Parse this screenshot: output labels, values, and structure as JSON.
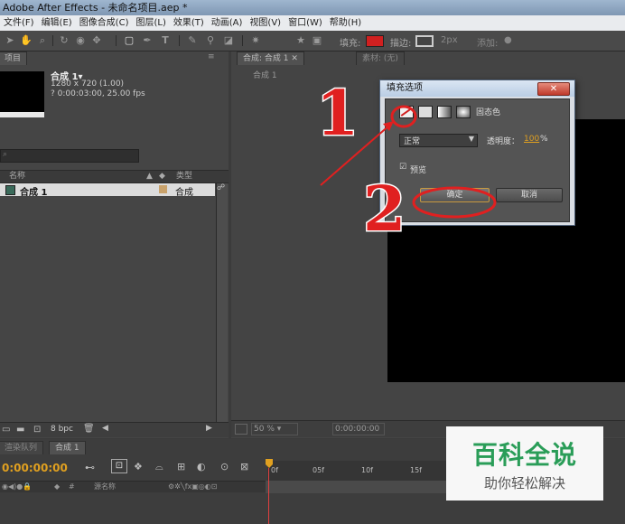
{
  "window_title": "Adobe After Effects - 未命名项目.aep *",
  "menu": [
    "文件(F)",
    "编辑(E)",
    "图像合成(C)",
    "图层(L)",
    "效果(T)",
    "动画(A)",
    "视图(V)",
    "窗口(W)",
    "帮助(H)"
  ],
  "toolbar": {
    "fill_label": "填充:",
    "stroke_label": "描边:",
    "stroke_width": "2px",
    "add_label": "添加:",
    "fill_color": "#d02020"
  },
  "project": {
    "tab": "项目",
    "comp_name": "合成 1▾",
    "comp_info1": "1280 x 720 (1.00)",
    "comp_info2": "? 0:00:03:00, 25.00 fps",
    "col_name": "名称",
    "col_type": "类型",
    "item_name": "合成 1",
    "item_type": "合成",
    "bpc": "8 bpc"
  },
  "composition": {
    "tab1": "合成: 合成 1",
    "tab2": "素材: (无)",
    "subtab": "合成 1",
    "zoom": "50 %",
    "timecode": "0:00:00:00"
  },
  "dialog": {
    "title": "填充选项",
    "fill_mode_label": "固态色",
    "blend_mode": "正常",
    "opacity_label": "透明度：",
    "opacity_value": "100",
    "opacity_unit": "%",
    "preview_label": "预览",
    "ok_label": "确定",
    "cancel_label": "取消"
  },
  "timeline": {
    "tab1": "渲染队列",
    "tab2": "合成 1",
    "current_time": "0:00:00:00",
    "col_source": "源名称",
    "ruler": [
      "0f",
      "05f",
      "10f",
      "15f"
    ]
  },
  "annotations": {
    "step1": "1",
    "step2": "2",
    "color": "#e02020"
  },
  "watermark": {
    "title": "百科全说",
    "subtitle": "助你轻松解决"
  }
}
